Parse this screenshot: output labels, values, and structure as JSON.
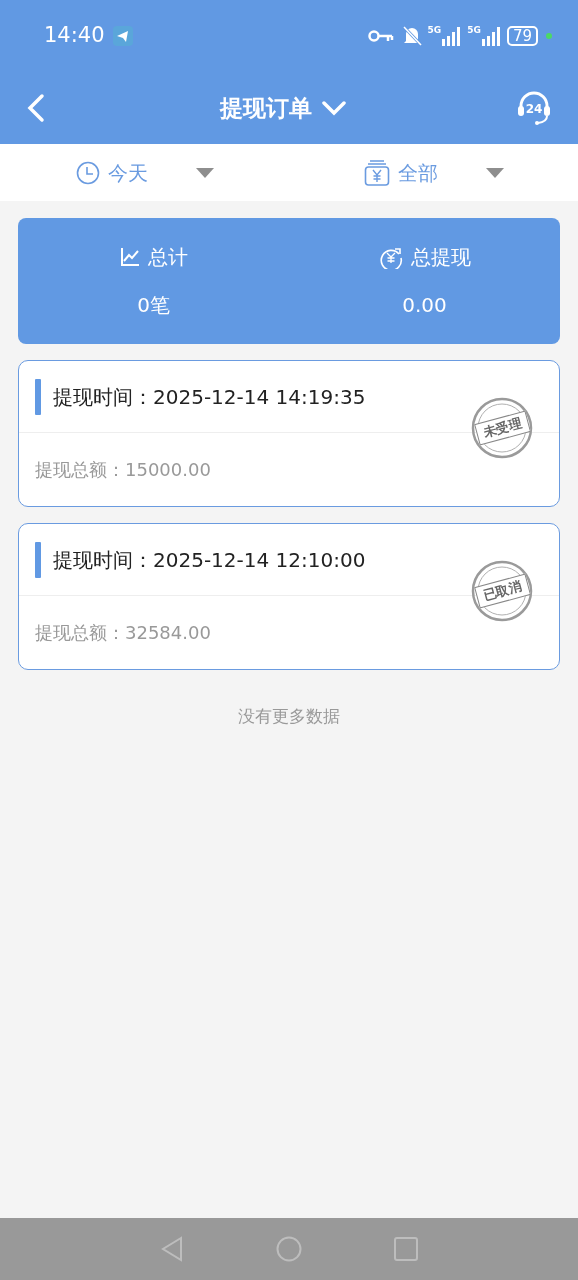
{
  "status_bar": {
    "time": "14:40",
    "battery": "79",
    "networks": [
      "5G",
      "5G"
    ]
  },
  "header": {
    "title": "提现订单",
    "service_badge": "24"
  },
  "filters": [
    {
      "kind": "time",
      "label": "今天"
    },
    {
      "kind": "money",
      "label": "全部"
    }
  ],
  "summary": [
    {
      "kind": "chart",
      "label": "总计",
      "value": "0笔"
    },
    {
      "kind": "withdraw",
      "label": "总提现",
      "value": "0.00"
    }
  ],
  "orders": [
    {
      "time_label": "提现时间：",
      "time": "2025-12-14 14:19:35",
      "amount_label": "提现总额：",
      "amount": "15000.00",
      "stamp": "未受理"
    },
    {
      "time_label": "提现时间：",
      "time": "2025-12-14 12:10:00",
      "amount_label": "提现总额：",
      "amount": "32584.00",
      "stamp": "已取消"
    }
  ],
  "footer_note": "没有更多数据"
}
